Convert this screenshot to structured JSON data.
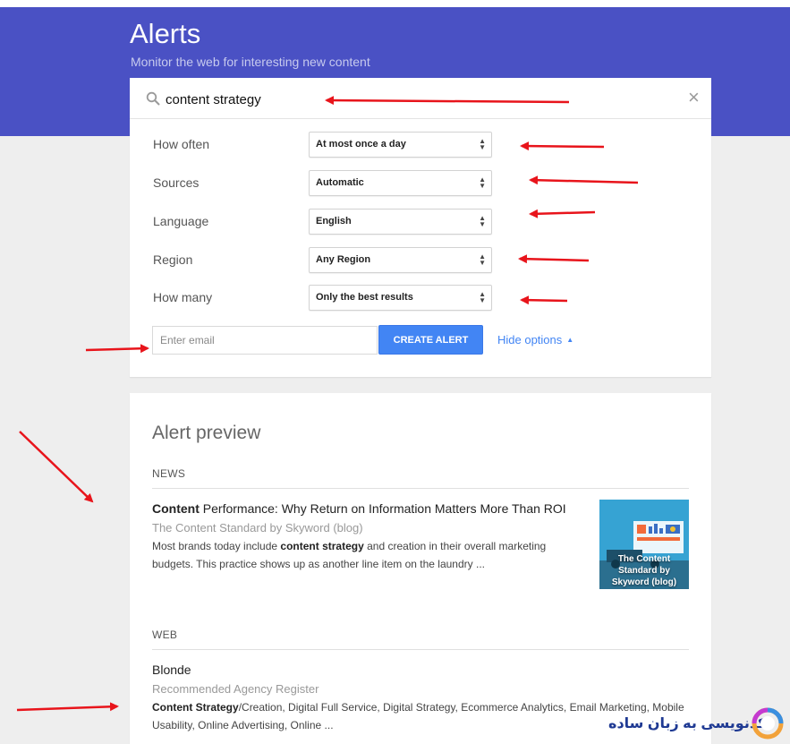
{
  "header": {
    "title": "Alerts",
    "subtitle": "Monitor the web for interesting new content"
  },
  "search": {
    "value": "content strategy",
    "clear_glyph": "×"
  },
  "options": [
    {
      "label": "How often",
      "value": "At most once a day"
    },
    {
      "label": "Sources",
      "value": "Automatic"
    },
    {
      "label": "Language",
      "value": "English"
    },
    {
      "label": "Region",
      "value": "Any Region"
    },
    {
      "label": "How many",
      "value": "Only the best results"
    }
  ],
  "email": {
    "placeholder": "Enter email"
  },
  "create_button": "CREATE ALERT",
  "hide_options": "Hide options",
  "preview": {
    "title": "Alert preview",
    "news": {
      "heading": "NEWS",
      "title_bold": "Content",
      "title_rest": " Performance: Why Return on Information Matters More Than ROI",
      "source": "The Content Standard by Skyword (blog)",
      "snippet_1": "Most brands today include ",
      "snippet_bold": "content strategy",
      "snippet_2": " and creation in their overall marketing",
      "snippet_line2": "budgets. This practice shows up as another line item on the laundry ...",
      "thumbnail_caption_1": "The Content",
      "thumbnail_caption_2": "Standard by",
      "thumbnail_caption_3": "Skyword (blog)"
    },
    "web": {
      "heading": "WEB",
      "title": "Blonde",
      "source": "Recommended Agency Register",
      "snippet_bold": "Content Strategy",
      "snippet_1": "/Creation, Digital Full Service, Digital Strategy, Ecommerce Analytics, Email Marketing, Mobile",
      "snippet_line2": "Usability, Online Advertising, Online ..."
    }
  },
  "watermark": {
    "text": "کدنویسی به زبان ساده"
  },
  "colors": {
    "header_band": "#4a51c4",
    "accent_blue": "#4285f4",
    "annotation_arrow": "#e8141b"
  },
  "icons": {
    "search": "search-icon",
    "clear": "close-icon",
    "select_arrows": "sort-arrows-icon",
    "caret": "caret-up-icon"
  }
}
